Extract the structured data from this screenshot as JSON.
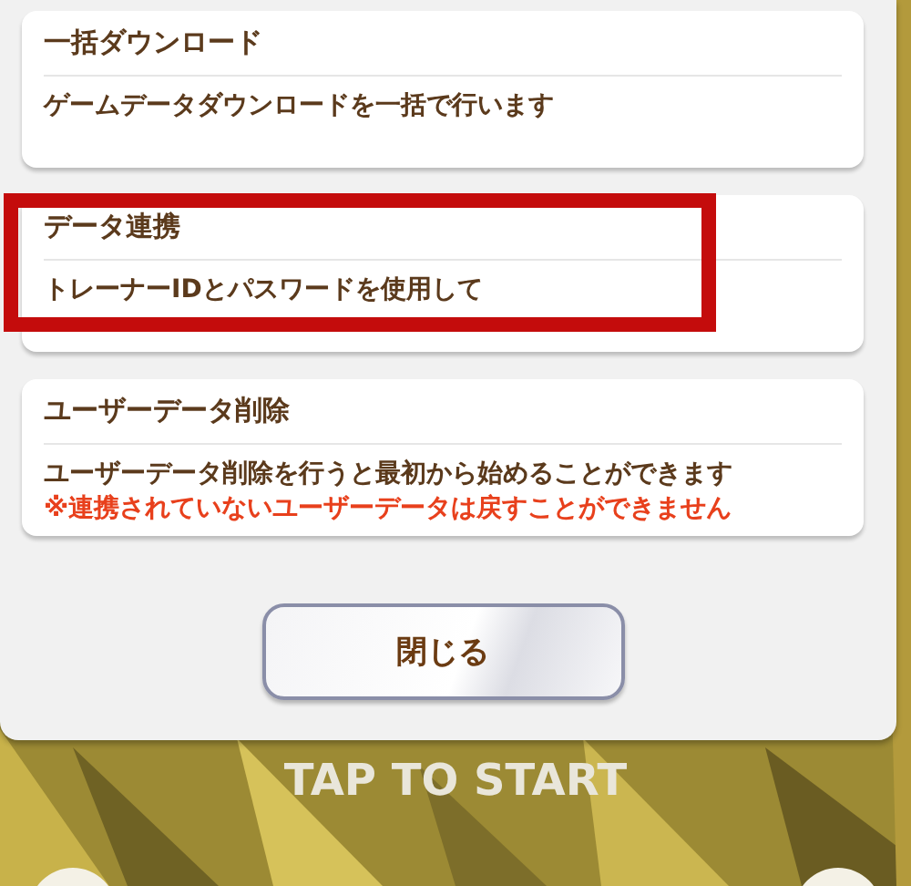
{
  "sections": [
    {
      "title": "一括ダウンロード",
      "highlighted": false,
      "lines": [
        {
          "kind": "normal",
          "text": "ゲームデータダウンロードを一括で行います"
        }
      ]
    },
    {
      "title": "データ連携",
      "highlighted": true,
      "lines": [
        {
          "kind": "normal",
          "text": "トレーナーIDとパスワードを使用して"
        }
      ]
    },
    {
      "title": "ユーザーデータ削除",
      "highlighted": false,
      "lines": [
        {
          "kind": "normal",
          "text": "ユーザーデータ削除を行うと最初から始めることができます"
        },
        {
          "kind": "warning",
          "text": "※連携されていないユーザーデータは戻すことができません"
        }
      ]
    }
  ],
  "close_button": "閉じる",
  "background": {
    "kind": "picture",
    "prompt": "TAP TO START"
  }
}
